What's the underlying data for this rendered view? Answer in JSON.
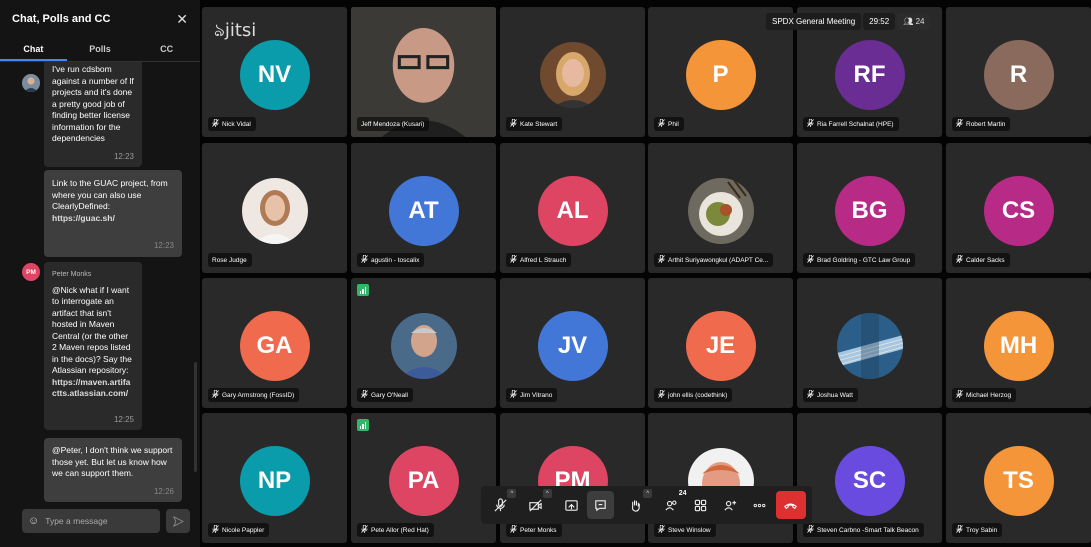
{
  "sidebar": {
    "title": "Chat, Polls and CC",
    "tabs": [
      "Chat",
      "Polls",
      "CC"
    ],
    "messages": [
      {
        "text": "I've run cdsbom against a number of lf projects and it's done a pretty good job of finding better license information for the dependencies",
        "time": "12:23",
        "local": false
      },
      {
        "text": "Link to the GUAC project, from where you can also use ClearlyDefined:",
        "link": "https://guac.sh/",
        "time": "12:23",
        "local": true
      },
      {
        "sender": "Peter Monks",
        "initials": "PM",
        "text": "@Nick what if I want to interrogate an artifact that isn't hosted in Maven Central (or the other 2 Maven repos listed in the docs)?  Say the Atlassian repository:",
        "link": "https://maven.artifactts.atlassian.com/",
        "time": "12:25",
        "local": false
      },
      {
        "text": "@Peter, I don't think we support those yet. But let us know how we can support them.",
        "time": "12:26",
        "local": true
      }
    ],
    "input_placeholder": "Type a message"
  },
  "header": {
    "logo": "jitsi",
    "meeting_name": "SPDX General Meeting",
    "timer": "29:52",
    "participant_count": "24"
  },
  "tiles": [
    {
      "name": "Nick Vidal",
      "initials": "NV",
      "color": "#0b9cab",
      "muted": true
    },
    {
      "name": "Jeff Mendoza (Kusari)",
      "photo": "man-glasses",
      "muted": false,
      "active": true
    },
    {
      "name": "Kate Stewart",
      "photo": "woman-blonde",
      "muted": true
    },
    {
      "name": "Phil",
      "initials": "P",
      "color": "#f4953a",
      "muted": true
    },
    {
      "name": "Ria Farrell Schalnat (HPE)",
      "initials": "RF",
      "color": "#6a2d93",
      "muted": true
    },
    {
      "name": "Robert Martin",
      "initials": "R",
      "color": "#8b6a5e",
      "muted": true
    },
    {
      "name": "Rose Judge",
      "photo": "woman-smiling",
      "muted": false
    },
    {
      "name": "agustin - toscalix",
      "initials": "AT",
      "color": "#4277d8",
      "muted": true
    },
    {
      "name": "Alfred L Strauch",
      "initials": "AL",
      "color": "#dd4563",
      "muted": true
    },
    {
      "name": "Arthit Suriyawongkul (ADAPT Ce...",
      "photo": "food-plate",
      "muted": true
    },
    {
      "name": "Brad Goldring - GTC Law Group",
      "initials": "BG",
      "color": "#b72a86",
      "muted": true
    },
    {
      "name": "Calder Sacks",
      "initials": "CS",
      "color": "#b72a86",
      "muted": true
    },
    {
      "name": "Gary Armstrong (FossID)",
      "initials": "GA",
      "color": "#f06a4d",
      "muted": true
    },
    {
      "name": "Gary O'Neall",
      "photo": "man-grey",
      "muted": true,
      "quality": true
    },
    {
      "name": "Jim Vitrano",
      "initials": "JV",
      "color": "#4277d8",
      "muted": true
    },
    {
      "name": "john ellis (codethink)",
      "initials": "JE",
      "color": "#f06a4d",
      "muted": true
    },
    {
      "name": "Joshua Watt",
      "photo": "guitar",
      "muted": true
    },
    {
      "name": "Michael Herzog",
      "initials": "MH",
      "color": "#f4953a",
      "muted": true
    },
    {
      "name": "Nicole Pappler",
      "initials": "NP",
      "color": "#0b9cab",
      "muted": true
    },
    {
      "name": "Pete Allor (Red Hat)",
      "initials": "PA",
      "color": "#dd4563",
      "muted": true,
      "quality": true
    },
    {
      "name": "Peter Monks",
      "initials": "PM",
      "color": "#dd4563",
      "muted": true
    },
    {
      "name": "Steve Winslow",
      "photo": "man-red",
      "muted": true
    },
    {
      "name": "Steven Carbno -Smart Talk Beacon",
      "initials": "SC",
      "color": "#6a4be0",
      "muted": true
    },
    {
      "name": "Troy Sabin",
      "initials": "TS",
      "color": "#f4953a",
      "muted": true
    }
  ],
  "toolbar": {
    "participants_badge": "24"
  },
  "colors": {
    "accent": "#4687ed",
    "hangup": "#dd3030",
    "tile_bg": "#292929"
  }
}
